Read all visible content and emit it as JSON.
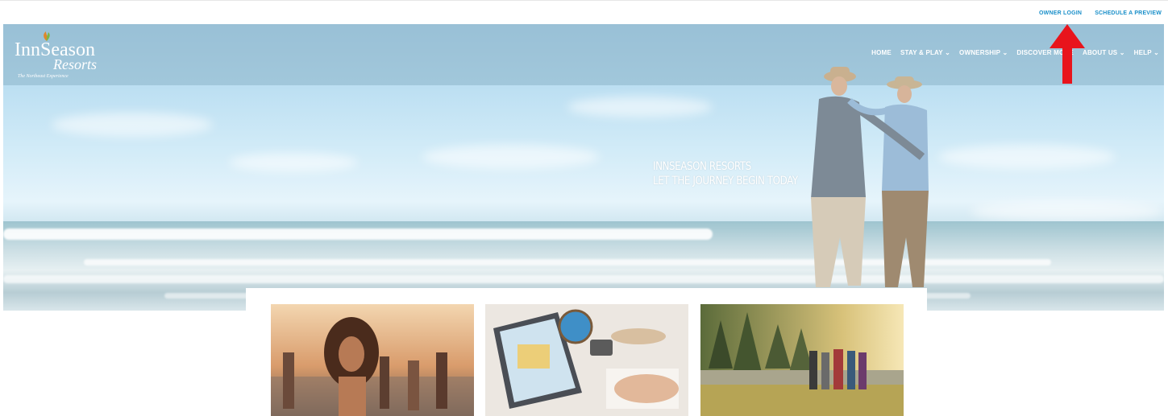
{
  "topbar": {
    "links": [
      "OWNER LOGIN",
      "SCHEDULE A PREVIEW"
    ]
  },
  "brand": {
    "name": "InnSeason",
    "sub": "Resorts",
    "tagline": "The Northeast Experience"
  },
  "nav": {
    "items": [
      "HOME",
      "STAY & PLAY ⌄",
      "OWNERSHIP ⌄",
      "DISCOVER MORE",
      "ABOUT US ⌄",
      "HELP ⌄"
    ]
  },
  "hero": {
    "line1": "INNSEASON RESORTS",
    "line2": "LET THE JOURNEY BEGIN TODAY"
  },
  "colors": {
    "link": "#1a8fc9",
    "annotation_arrow": "#e8141c"
  },
  "icons": [
    "leaf-logo-icon",
    "red-arrow-annotation"
  ],
  "cards": [
    "beach-friends-image",
    "travel-planning-image",
    "forest-hikers-image"
  ]
}
